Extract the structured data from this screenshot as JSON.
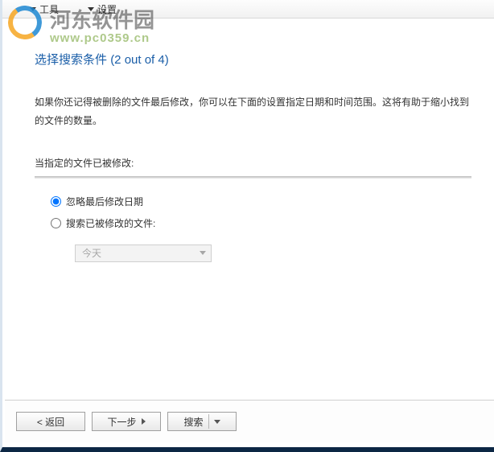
{
  "menu": {
    "tools": "工具",
    "settings": "设置"
  },
  "watermark": {
    "title": "河东软件园",
    "url": "www.pc0359.cn"
  },
  "page": {
    "title_prefix": "选择搜索条件",
    "title_counter": "(2 out of 4)",
    "description": "如果你还记得被删除的文件最后修改，你可以在下面的设置指定日期和时间范围。这将有助于缩小找到的文件的数量。"
  },
  "section": {
    "label": "当指定的文件已被修改:"
  },
  "radios": {
    "ignore": "忽略最后修改日期",
    "searchModified": "搜索已被修改的文件:"
  },
  "dropdown": {
    "value": "今天"
  },
  "buttons": {
    "back": "< 返回",
    "next": "下一步",
    "search": "搜索"
  }
}
